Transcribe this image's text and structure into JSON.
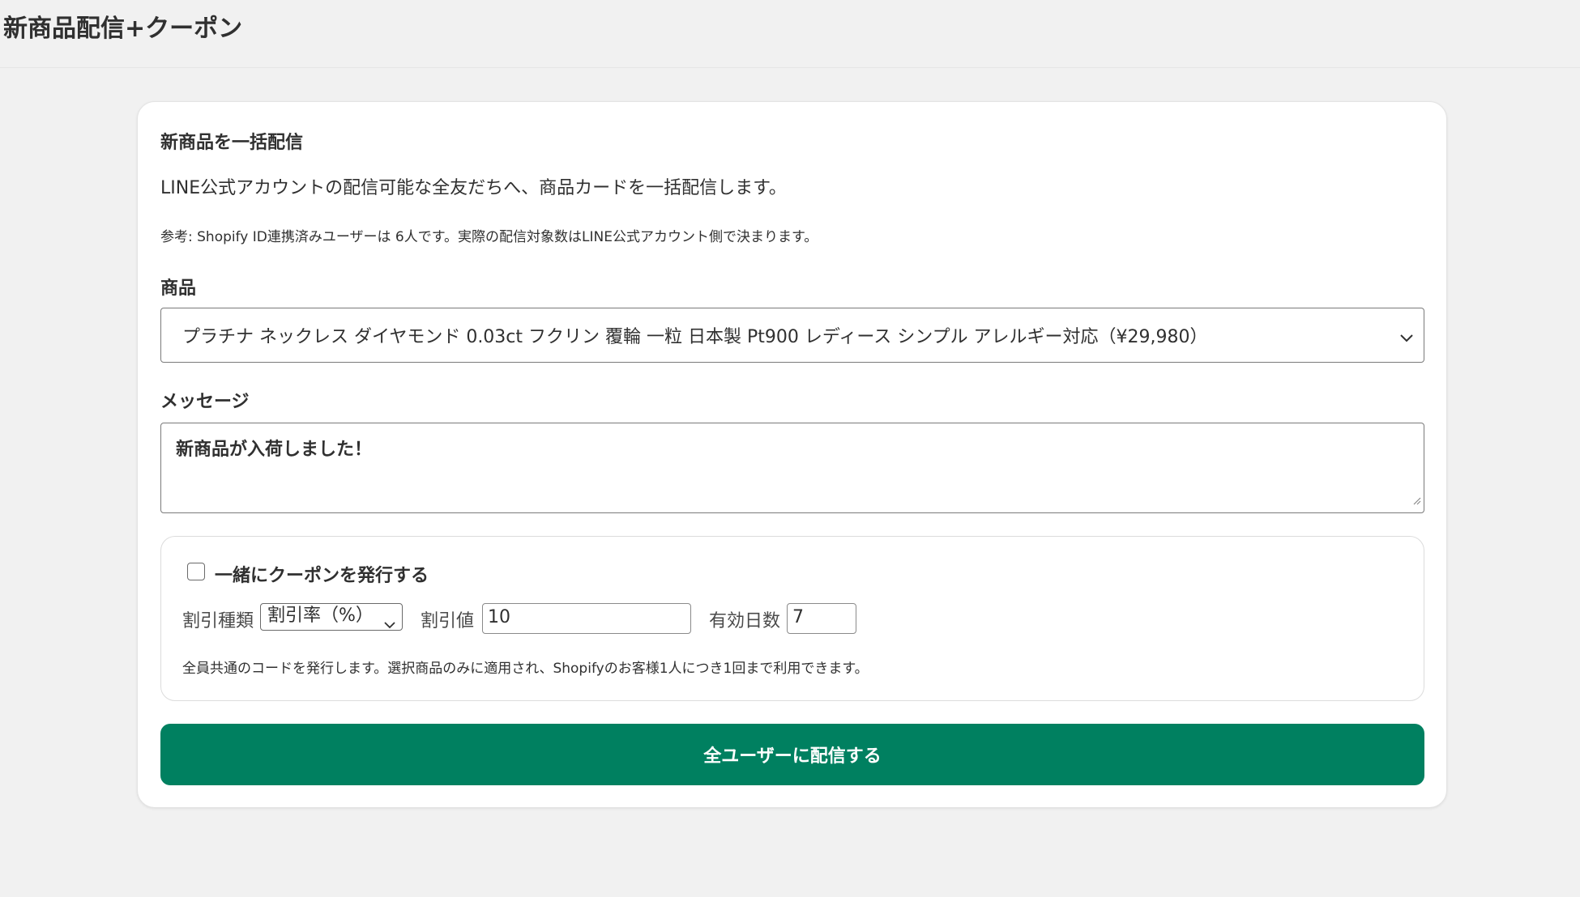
{
  "page": {
    "title": "新商品配信+クーポン"
  },
  "card": {
    "title": "新商品を一括配信",
    "description": "LINE公式アカウントの配信可能な全友だちへ、商品カードを一括配信します。",
    "note": "参考: Shopify ID連携済みユーザーは 6人です。実際の配信対象数はLINE公式アカウント側で決まります。"
  },
  "product": {
    "label": "商品",
    "selected": "プラチナ ネックレス ダイヤモンド 0.03ct フクリン 覆輪 一粒 日本製 Pt900 レディース シンプル アレルギー対応（¥29,980）"
  },
  "message": {
    "label": "メッセージ",
    "value": "新商品が入荷しました！"
  },
  "coupon": {
    "checkbox_label": "一緒にクーポンを発行する",
    "checked": false,
    "discount_type_label": "割引種類",
    "discount_type_value": "割引率（%）",
    "discount_value_label": "割引値",
    "discount_value": "10",
    "valid_days_label": "有効日数",
    "valid_days": "7",
    "note": "全員共通のコードを発行します。選択商品のみに適用され、Shopifyのお客様1人につき1回まで利用できます。"
  },
  "submit": {
    "label": "全ユーザーに配信する"
  },
  "colors": {
    "primary": "#008060",
    "background": "#f1f1f1",
    "card": "#ffffff"
  }
}
